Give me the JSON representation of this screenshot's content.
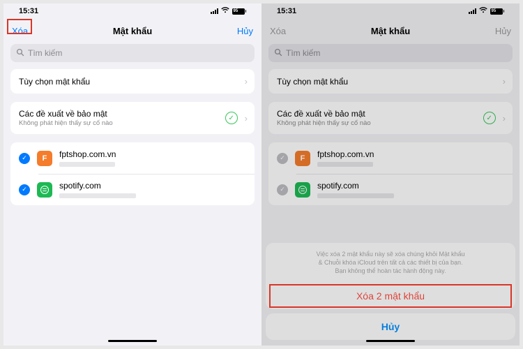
{
  "statusbar": {
    "time": "15:31",
    "battery": "95"
  },
  "nav": {
    "left": "Xóa",
    "title": "Mật khẩu",
    "right": "Hủy"
  },
  "search": {
    "placeholder": "Tìm kiếm"
  },
  "options_row": {
    "title": "Tùy chọn mật khẩu"
  },
  "security_row": {
    "title": "Các đề xuất về bảo mật",
    "subtitle": "Không phát hiện thấy sự cố nào"
  },
  "passwords": [
    {
      "site": "fptshop.com.vn",
      "icon_letter": "F",
      "icon_class": "orange"
    },
    {
      "site": "spotify.com",
      "icon_letter": "",
      "icon_class": "spotify"
    }
  ],
  "sheet": {
    "message_l1": "Việc xóa 2 mật khẩu này sẽ xóa chúng khỏi Mật khẩu",
    "message_l2": "& Chuỗi khóa iCloud trên tất cả các thiết bị của bạn.",
    "message_l3": "Bạn không thể hoàn tác hành động này.",
    "destructive": "Xóa 2 mật khẩu",
    "cancel": "Hủy"
  }
}
